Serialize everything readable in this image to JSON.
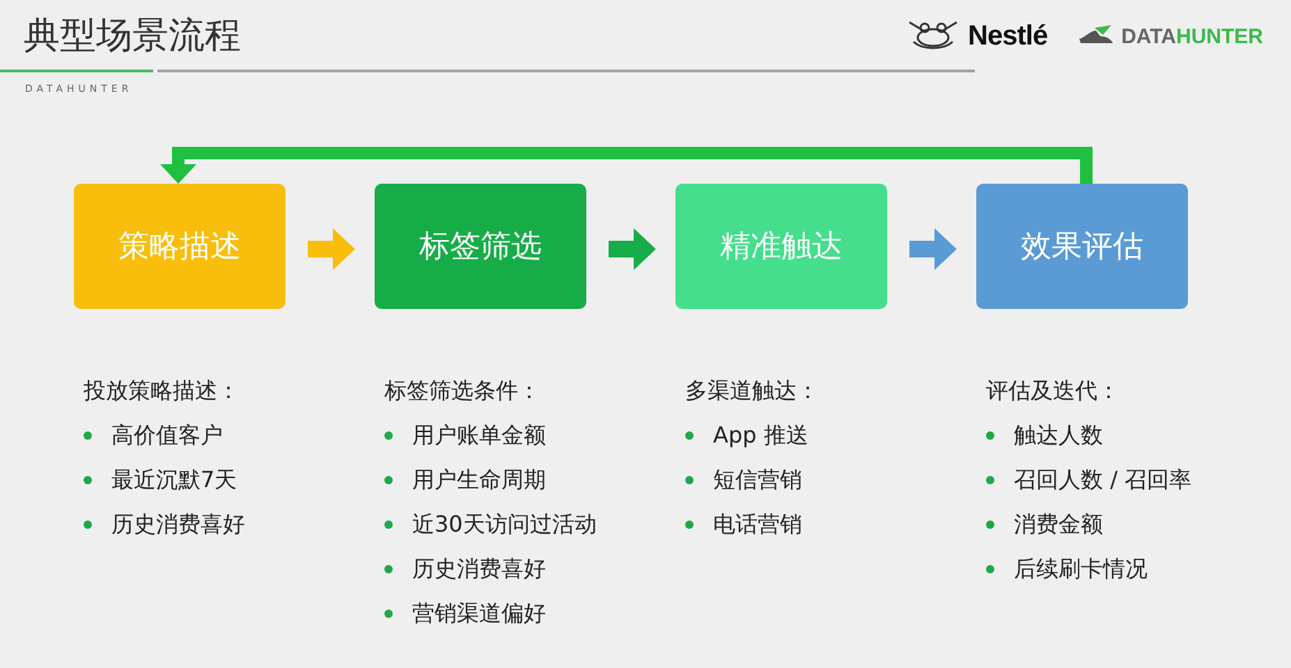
{
  "header": {
    "title": "典型场景流程",
    "subtitle": "DATAHUNTER",
    "logos": [
      {
        "kind": "nestle",
        "text": "Nestlé"
      },
      {
        "kind": "datahunter",
        "parts": [
          "DATA",
          "HUNTER"
        ]
      }
    ]
  },
  "steps": [
    {
      "label": "策略描述",
      "color": "#f9be0c",
      "heading": "投放策略描述：",
      "items": [
        "高价值客户",
        "最近沉默7天",
        "历史消费喜好"
      ]
    },
    {
      "label": "标签筛选",
      "color": "#16ad48",
      "heading": "标签筛选条件：",
      "items": [
        "用户账单金额",
        "用户生命周期",
        "近30天访问过活动",
        "历史消费喜好",
        "营销渠道偏好"
      ]
    },
    {
      "label": "精准触达",
      "color": "#44de8c",
      "heading": "多渠道触达：",
      "items": [
        "App 推送",
        "短信营销",
        "电话营销"
      ]
    },
    {
      "label": "效果评估",
      "color": "#5b9bd5",
      "heading": "评估及迭代：",
      "items": [
        "触达人数",
        "召回人数 / 召回率",
        "消费金额",
        "后续刷卡情况"
      ]
    }
  ]
}
